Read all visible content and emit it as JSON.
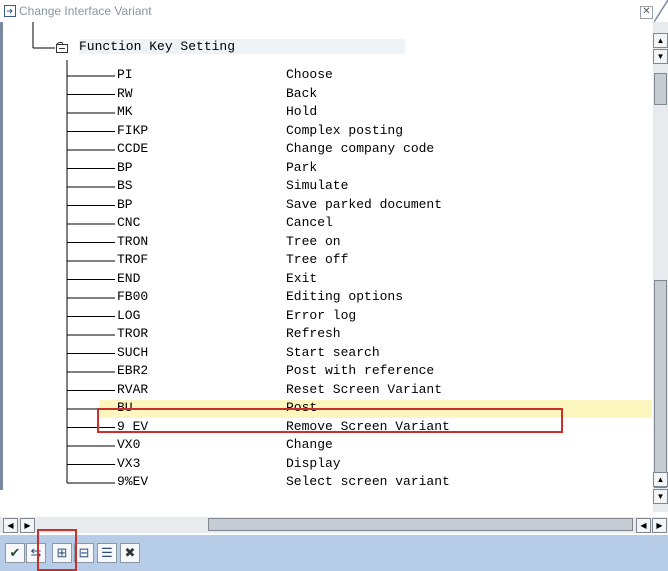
{
  "window": {
    "title": "Change Interface Variant",
    "close_glyph": "✕"
  },
  "tree": {
    "root": {
      "label": "Function Key Setting",
      "icon": "folder-icon"
    },
    "rows": [
      {
        "key": "PI",
        "desc": "Choose"
      },
      {
        "key": "RW",
        "desc": "Back"
      },
      {
        "key": "MK",
        "desc": "Hold"
      },
      {
        "key": "FIKP",
        "desc": "Complex posting"
      },
      {
        "key": "CCDE",
        "desc": "Change company code"
      },
      {
        "key": "BP",
        "desc": "Park"
      },
      {
        "key": "BS",
        "desc": "Simulate"
      },
      {
        "key": "BP",
        "desc": "Save parked document"
      },
      {
        "key": "CNC",
        "desc": "Cancel"
      },
      {
        "key": "TRON",
        "desc": "Tree on"
      },
      {
        "key": "TROF",
        "desc": "Tree off"
      },
      {
        "key": "END",
        "desc": "Exit"
      },
      {
        "key": "FB00",
        "desc": "Editing options"
      },
      {
        "key": "LOG",
        "desc": "Error log"
      },
      {
        "key": "TROR",
        "desc": "Refresh"
      },
      {
        "key": "SUCH",
        "desc": "Start search"
      },
      {
        "key": "EBR2",
        "desc": "Post with reference"
      },
      {
        "key": "RVAR",
        "desc": "Reset Screen Variant"
      },
      {
        "key": "BU",
        "desc": "Post",
        "highlighted": true
      },
      {
        "key": "9_EV",
        "desc": "Remove Screen Variant"
      },
      {
        "key": "VX0",
        "desc": "Change"
      },
      {
        "key": "VX3",
        "desc": "Display"
      },
      {
        "key": "9%EV",
        "desc": "Select screen variant"
      }
    ]
  },
  "toolbar": {
    "buttons": [
      {
        "name": "confirm-button",
        "icon": "checkmark-icon",
        "glyph": "✔"
      },
      {
        "name": "translate-button",
        "icon": "swap-icon",
        "glyph": "⇆"
      },
      {
        "name": "expand-subtree-button",
        "icon": "expand-icon",
        "glyph": "⊞"
      },
      {
        "name": "collapse-subtree-button",
        "icon": "collapse-icon",
        "glyph": "⊟"
      },
      {
        "name": "details-button",
        "icon": "list-icon",
        "glyph": "☰"
      },
      {
        "name": "cancel-button",
        "icon": "x-icon",
        "glyph": "✖"
      }
    ]
  },
  "colors": {
    "toolbar_bg": "#b7cce6",
    "highlight_row": "#fdf6be",
    "annotation_red": "#c9302c"
  }
}
